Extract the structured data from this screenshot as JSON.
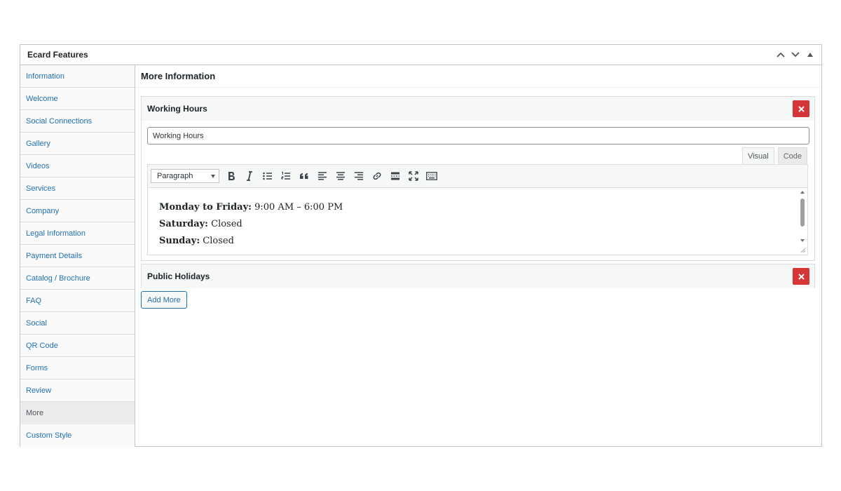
{
  "metabox": {
    "title": "Ecard Features"
  },
  "sidebar": {
    "items": [
      {
        "label": "Information"
      },
      {
        "label": "Welcome"
      },
      {
        "label": "Social Connections"
      },
      {
        "label": "Gallery"
      },
      {
        "label": "Videos"
      },
      {
        "label": "Services"
      },
      {
        "label": "Company"
      },
      {
        "label": "Legal Information"
      },
      {
        "label": "Payment Details"
      },
      {
        "label": "Catalog / Brochure"
      },
      {
        "label": "FAQ"
      },
      {
        "label": "Social"
      },
      {
        "label": "QR Code"
      },
      {
        "label": "Forms"
      },
      {
        "label": "Review"
      },
      {
        "label": "More"
      },
      {
        "label": "Custom Style"
      }
    ],
    "active": "More"
  },
  "main": {
    "title": "More Information",
    "panels": [
      {
        "title": "Working Hours",
        "input_value": "Working Hours",
        "editor": {
          "tabs": [
            "Visual",
            "Code"
          ],
          "active_tab": "Visual",
          "format": "Paragraph",
          "lines": [
            {
              "label": "Monday to Friday:",
              "value": " 9:00 AM – 6:00 PM"
            },
            {
              "label": "Saturday:",
              "value": " Closed"
            },
            {
              "label": "Sunday:",
              "value": " Closed"
            }
          ]
        }
      },
      {
        "title": "Public Holidays"
      }
    ],
    "add_more_label": "Add More"
  },
  "colors": {
    "accent": "#2271b1",
    "delete": "#d63638"
  }
}
